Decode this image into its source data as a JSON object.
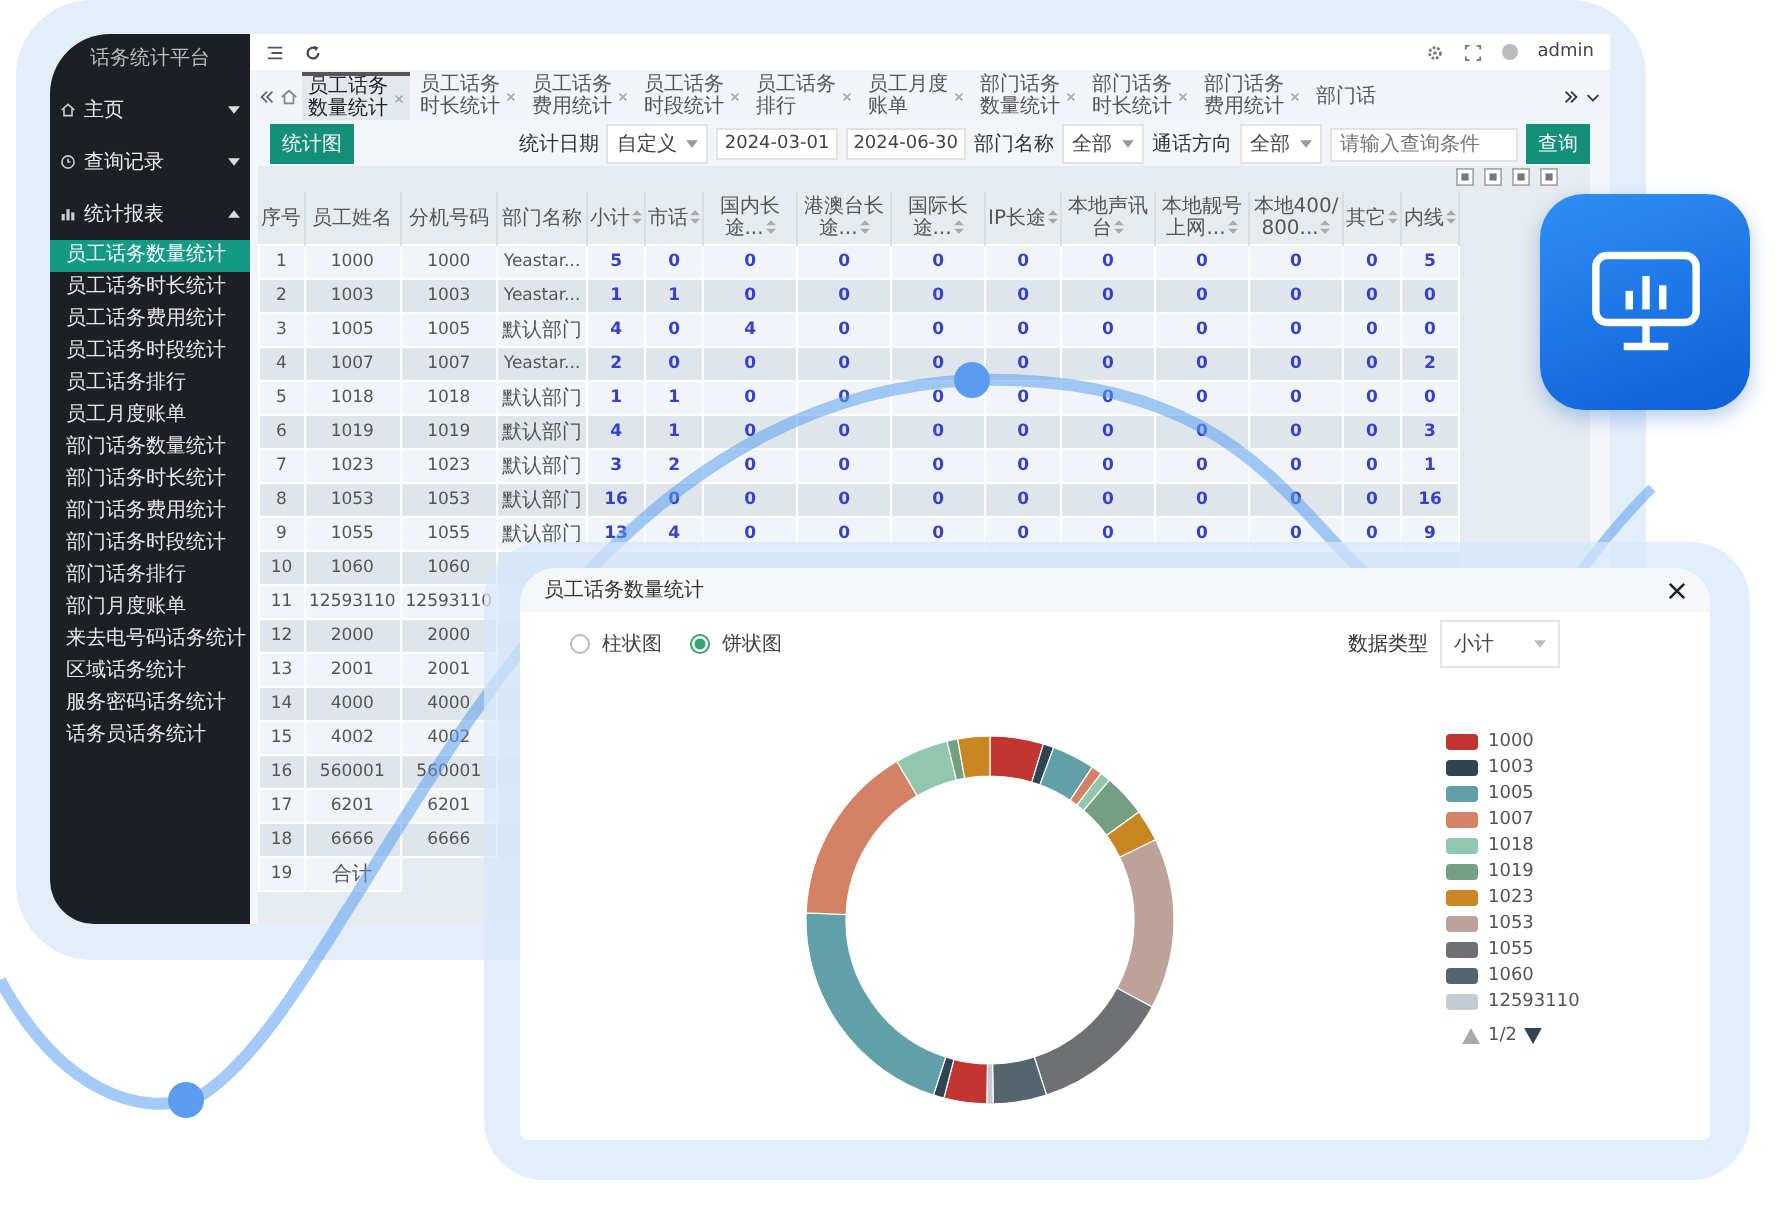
{
  "sidebar": {
    "title": "话务统计平台",
    "items": [
      {
        "label": "主页",
        "kind": "home",
        "expanded": false
      },
      {
        "label": "查询记录",
        "kind": "query",
        "expanded": false
      },
      {
        "label": "统计报表",
        "kind": "report",
        "expanded": true,
        "children": [
          {
            "label": "员工话务数量统计",
            "selected": true
          },
          {
            "label": "员工话务时长统计",
            "selected": false
          },
          {
            "label": "员工话务费用统计",
            "selected": false
          },
          {
            "label": "员工话务时段统计",
            "selected": false
          },
          {
            "label": "员工话务排行",
            "selected": false
          },
          {
            "label": "员工月度账单",
            "selected": false
          },
          {
            "label": "部门话务数量统计",
            "selected": false
          },
          {
            "label": "部门话务时长统计",
            "selected": false
          },
          {
            "label": "部门话务费用统计",
            "selected": false
          },
          {
            "label": "部门话务时段统计",
            "selected": false
          },
          {
            "label": "部门话务排行",
            "selected": false
          },
          {
            "label": "部门月度账单",
            "selected": false
          },
          {
            "label": "来去电号码话务统计",
            "selected": false
          },
          {
            "label": "区域话务统计",
            "selected": false
          },
          {
            "label": "服务密码话务统计",
            "selected": false
          },
          {
            "label": "话务员话务统计",
            "selected": false
          }
        ]
      }
    ]
  },
  "topbar": {
    "user": "admin"
  },
  "tabs": [
    {
      "label": "员工话务数量统计",
      "selected": true,
      "closable": true
    },
    {
      "label": "员工话务时长统计",
      "selected": false,
      "closable": true
    },
    {
      "label": "员工话务费用统计",
      "selected": false,
      "closable": true
    },
    {
      "label": "员工话务时段统计",
      "selected": false,
      "closable": true
    },
    {
      "label": "员工话务排行",
      "selected": false,
      "closable": true
    },
    {
      "label": "员工月度账单",
      "selected": false,
      "closable": true
    },
    {
      "label": "部门话务数量统计",
      "selected": false,
      "closable": true
    },
    {
      "label": "部门话务时长统计",
      "selected": false,
      "closable": true
    },
    {
      "label": "部门话务费用统计",
      "selected": false,
      "closable": true
    },
    {
      "label": "部门话",
      "selected": false,
      "closable": false
    }
  ],
  "toolbar": {
    "chart_button": "统计图",
    "date_label": "统计日期",
    "date_mode": "自定义",
    "date_from": "2024-03-01",
    "date_to": "2024-06-30",
    "dept_label": "部门名称",
    "dept_value": "全部",
    "direction_label": "通话方向",
    "direction_value": "全部",
    "search_placeholder": "请输入查询条件",
    "search_button": "查询"
  },
  "table": {
    "columns": [
      {
        "label": "序号",
        "sortable": false
      },
      {
        "label": "员工姓名",
        "sortable": false
      },
      {
        "label": "分机号码",
        "sortable": false
      },
      {
        "label": "部门名称",
        "sortable": false
      },
      {
        "label": "小计",
        "sortable": true
      },
      {
        "label": "市话",
        "sortable": true
      },
      {
        "label": "国内长途...",
        "sortable": true
      },
      {
        "label": "港澳台长途...",
        "sortable": true
      },
      {
        "label": "国际长途...",
        "sortable": true
      },
      {
        "label": "IP长途",
        "sortable": true
      },
      {
        "label": "本地声讯台",
        "sortable": true
      },
      {
        "label": "本地靓号上网...",
        "sortable": true
      },
      {
        "label": "本地400/800...",
        "sortable": true
      },
      {
        "label": "其它",
        "sortable": true
      },
      {
        "label": "内线",
        "sortable": true
      }
    ],
    "rows": [
      {
        "cells": [
          "1",
          "1000",
          "1000",
          "Yeastar...",
          "5",
          "0",
          "0",
          "0",
          "0",
          "0",
          "0",
          "0",
          "0",
          "0",
          "5"
        ]
      },
      {
        "cells": [
          "2",
          "1003",
          "1003",
          "Yeastar...",
          "1",
          "1",
          "0",
          "0",
          "0",
          "0",
          "0",
          "0",
          "0",
          "0",
          "0"
        ]
      },
      {
        "cells": [
          "3",
          "1005",
          "1005",
          "默认部门",
          "4",
          "0",
          "4",
          "0",
          "0",
          "0",
          "0",
          "0",
          "0",
          "0",
          "0"
        ]
      },
      {
        "cells": [
          "4",
          "1007",
          "1007",
          "Yeastar...",
          "2",
          "0",
          "0",
          "0",
          "0",
          "0",
          "0",
          "0",
          "0",
          "0",
          "2"
        ]
      },
      {
        "cells": [
          "5",
          "1018",
          "1018",
          "默认部门",
          "1",
          "1",
          "0",
          "0",
          "0",
          "0",
          "0",
          "0",
          "0",
          "0",
          "0"
        ]
      },
      {
        "cells": [
          "6",
          "1019",
          "1019",
          "默认部门",
          "4",
          "1",
          "0",
          "0",
          "0",
          "0",
          "0",
          "0",
          "0",
          "0",
          "3"
        ]
      },
      {
        "cells": [
          "7",
          "1023",
          "1023",
          "默认部门",
          "3",
          "2",
          "0",
          "0",
          "0",
          "0",
          "0",
          "0",
          "0",
          "0",
          "1"
        ]
      },
      {
        "cells": [
          "8",
          "1053",
          "1053",
          "默认部门",
          "16",
          "0",
          "0",
          "0",
          "0",
          "0",
          "0",
          "0",
          "0",
          "0",
          "16"
        ]
      },
      {
        "cells": [
          "9",
          "1055",
          "1055",
          "默认部门",
          "13",
          "4",
          "0",
          "0",
          "0",
          "0",
          "0",
          "0",
          "0",
          "0",
          "9"
        ]
      },
      {
        "cells": [
          "10",
          "1060",
          "1060"
        ]
      },
      {
        "cells": [
          "11",
          "12593110",
          "12593110"
        ]
      },
      {
        "cells": [
          "12",
          "2000",
          "2000"
        ]
      },
      {
        "cells": [
          "13",
          "2001",
          "2001"
        ]
      },
      {
        "cells": [
          "14",
          "4000",
          "4000"
        ]
      },
      {
        "cells": [
          "15",
          "4002",
          "4002"
        ]
      },
      {
        "cells": [
          "16",
          "560001",
          "560001"
        ]
      },
      {
        "cells": [
          "17",
          "6201",
          "6201"
        ]
      },
      {
        "cells": [
          "18",
          "6666",
          "6666"
        ]
      },
      {
        "cells": [
          "19",
          "合计"
        ]
      }
    ]
  },
  "dialog": {
    "title": "员工话务数量统计",
    "chart_types": [
      {
        "label": "柱状图",
        "selected": false
      },
      {
        "label": "饼状图",
        "selected": true
      }
    ],
    "data_type_label": "数据类型",
    "data_type_value": "小计",
    "legend": [
      {
        "label": "1000",
        "color": "#c23531"
      },
      {
        "label": "1003",
        "color": "#2f4554"
      },
      {
        "label": "1005",
        "color": "#61a0a8"
      },
      {
        "label": "1007",
        "color": "#d48265"
      },
      {
        "label": "1018",
        "color": "#91c7ae"
      },
      {
        "label": "1019",
        "color": "#749f83"
      },
      {
        "label": "1023",
        "color": "#ca8622"
      },
      {
        "label": "1053",
        "color": "#bda29a"
      },
      {
        "label": "1055",
        "color": "#6e7074"
      },
      {
        "label": "1060",
        "color": "#546570"
      },
      {
        "label": "12593110",
        "color": "#c4ccd3"
      }
    ],
    "pager": "1/2",
    "pager_prev_disabled": true,
    "pager_next_disabled": false
  }
}
